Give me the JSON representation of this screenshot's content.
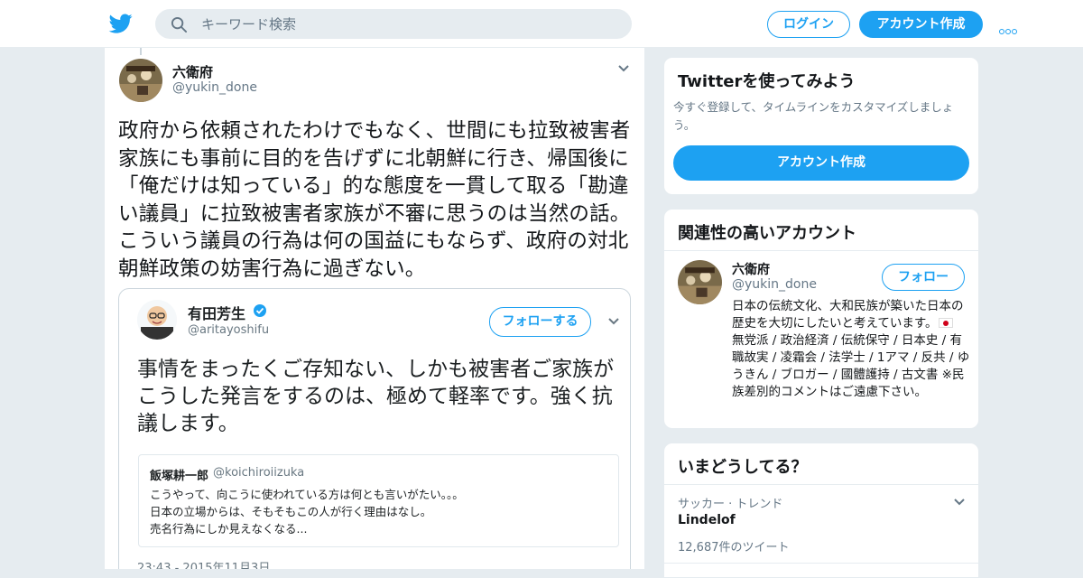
{
  "header": {
    "search_placeholder": "キーワード検索",
    "login_label": "ログイン",
    "signup_label": "アカウント作成"
  },
  "tweet": {
    "author_name": "六衛府",
    "author_handle": "@yukin_done",
    "text": "政府から依頼されたわけでもなく、世間にも拉致被害者家族にも事前に目的を告げずに北朝鮮に行き、帰国後に「俺だけは知っている」的な態度を一貫して取る「勘違い議員」に拉致被害者家族が不審に思うのは当然の話。こういう議員の行為は何の国益にもならず、政府の対北朝鮮政策の妨害行為に過ぎない。",
    "embed": {
      "author_name": "有田芳生",
      "author_handle": "@aritayoshifu",
      "follow_label": "フォローする",
      "text": "事情をまったくご存知ない、しかも被害者ご家族がこうした発言をするのは、極めて軽率です。強く抗議します。",
      "quote": {
        "author_name": "飯塚耕一郎",
        "author_handle": "@koichiroiizuka",
        "text": "こうやって、向こうに使われている方は何とも言いがたい。。。\n日本の立場からは、そもそもこの人が行く理由はなし。\n売名行為にしか見えなくなる..."
      },
      "timestamp": "23:43 - 2015年11月3日"
    }
  },
  "signup_module": {
    "title": "Twitterを使ってみよう",
    "description": "今すぐ登録して、タイムラインをカスタマイズしましょう。",
    "button_label": "アカウント作成"
  },
  "related_module": {
    "title": "関連性の高いアカウント",
    "account": {
      "name": "六衛府",
      "handle": "@yukin_done",
      "follow_label": "フォロー",
      "bio_before_flag": "日本の伝統文化、大和民族が築いた日本の歴史を大切にしたいと考えています。",
      "bio_after_flag": " 無党派 / 政治経済 / 伝統保守 / 日本史 / 有職故実 / 凌霜会 / 法学士 / 1アマ / 反共 / ゆうきん / ブロガー / 國體護持 / 古文書 ※民族差別的コメントはご遠慮下さい。"
    }
  },
  "trends_module": {
    "title": "いまどうしてる？",
    "trend": {
      "category": "サッカー · トレンド",
      "name": "Lindelof",
      "count": "12,687件のツイート"
    }
  },
  "colors": {
    "brand_blue": "#1da1f2",
    "background": "#e6ecf0"
  }
}
